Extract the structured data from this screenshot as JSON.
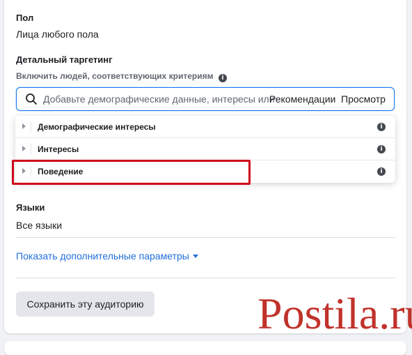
{
  "gender": {
    "label": "Пол",
    "value": "Лица любого пола"
  },
  "targeting": {
    "label": "Детальный таргетинг",
    "sublabel": "Включить людей, соответствующих критериям",
    "search_placeholder": "Добавьте демографические данные, интересы или",
    "tab_recommendations": "Рекомендации",
    "tab_browse": "Просмотр",
    "categories": [
      {
        "label": "Демографические интересы"
      },
      {
        "label": "Интересы"
      },
      {
        "label": "Поведение"
      }
    ]
  },
  "languages": {
    "label": "Языки",
    "value": "Все языки"
  },
  "more_options": {
    "label": "Показать дополнительные параметры"
  },
  "save_audience": {
    "label": "Сохранить эту аудиторию"
  },
  "watermark": {
    "text": "Postila.ru"
  },
  "colors": {
    "link": "#216fdb",
    "highlight": "#d0021b",
    "focus": "#1877f2",
    "watermark": "#c0322b"
  }
}
